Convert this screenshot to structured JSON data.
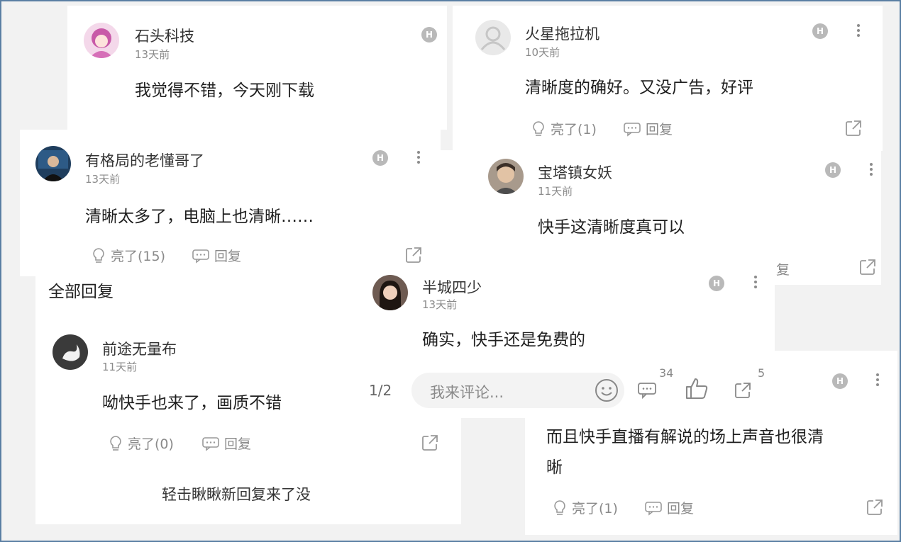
{
  "comments": {
    "shitou": {
      "username": "石头科技",
      "time": "13天前",
      "text": "我觉得不错，今天刚下载",
      "badge": "H"
    },
    "huoxing": {
      "username": "火星拖拉机",
      "time": "10天前",
      "text": "清晰度的确好。又没广告，好评",
      "badge": "H",
      "like_label": "亮了(1)",
      "reply_label": "回复"
    },
    "youge": {
      "username": "有格局的老懂哥了",
      "time": "13天前",
      "text": "清晰太多了，电脑上也清晰……",
      "badge": "H",
      "like_label": "亮了(15)",
      "reply_label": "回复"
    },
    "baota": {
      "username": "宝塔镇女妖",
      "time": "11天前",
      "text": "快手这清晰度真可以",
      "badge": "H",
      "partial_reply": "复"
    },
    "pancheng": {
      "username": "半城四少",
      "time": "13天前",
      "text": "确实，快手还是免费的",
      "badge": "H"
    },
    "qiantu": {
      "username": "前途无量布",
      "time": "11天前",
      "text": "呦快手也来了，画质不错",
      "like_label": "亮了(0)",
      "reply_label": "回复"
    },
    "erqie": {
      "text_line1": "而且快手直播有解说的场上声音也很清",
      "text_line2": "晰",
      "badge": "H",
      "like_label": "亮了(1)",
      "reply_label": "回复"
    }
  },
  "all_replies_label": "全部回复",
  "tap_new_replies": "轻击瞅瞅新回复来了没",
  "bottom_bar": {
    "page_indicator": "1/2",
    "comment_placeholder": "我来评论...",
    "comment_count": "34",
    "share_count": "5"
  },
  "colors": {
    "text_gray": "#8a8a8a",
    "badge_gray": "#b9b9b9",
    "frame_blue": "#5a7fa3"
  }
}
